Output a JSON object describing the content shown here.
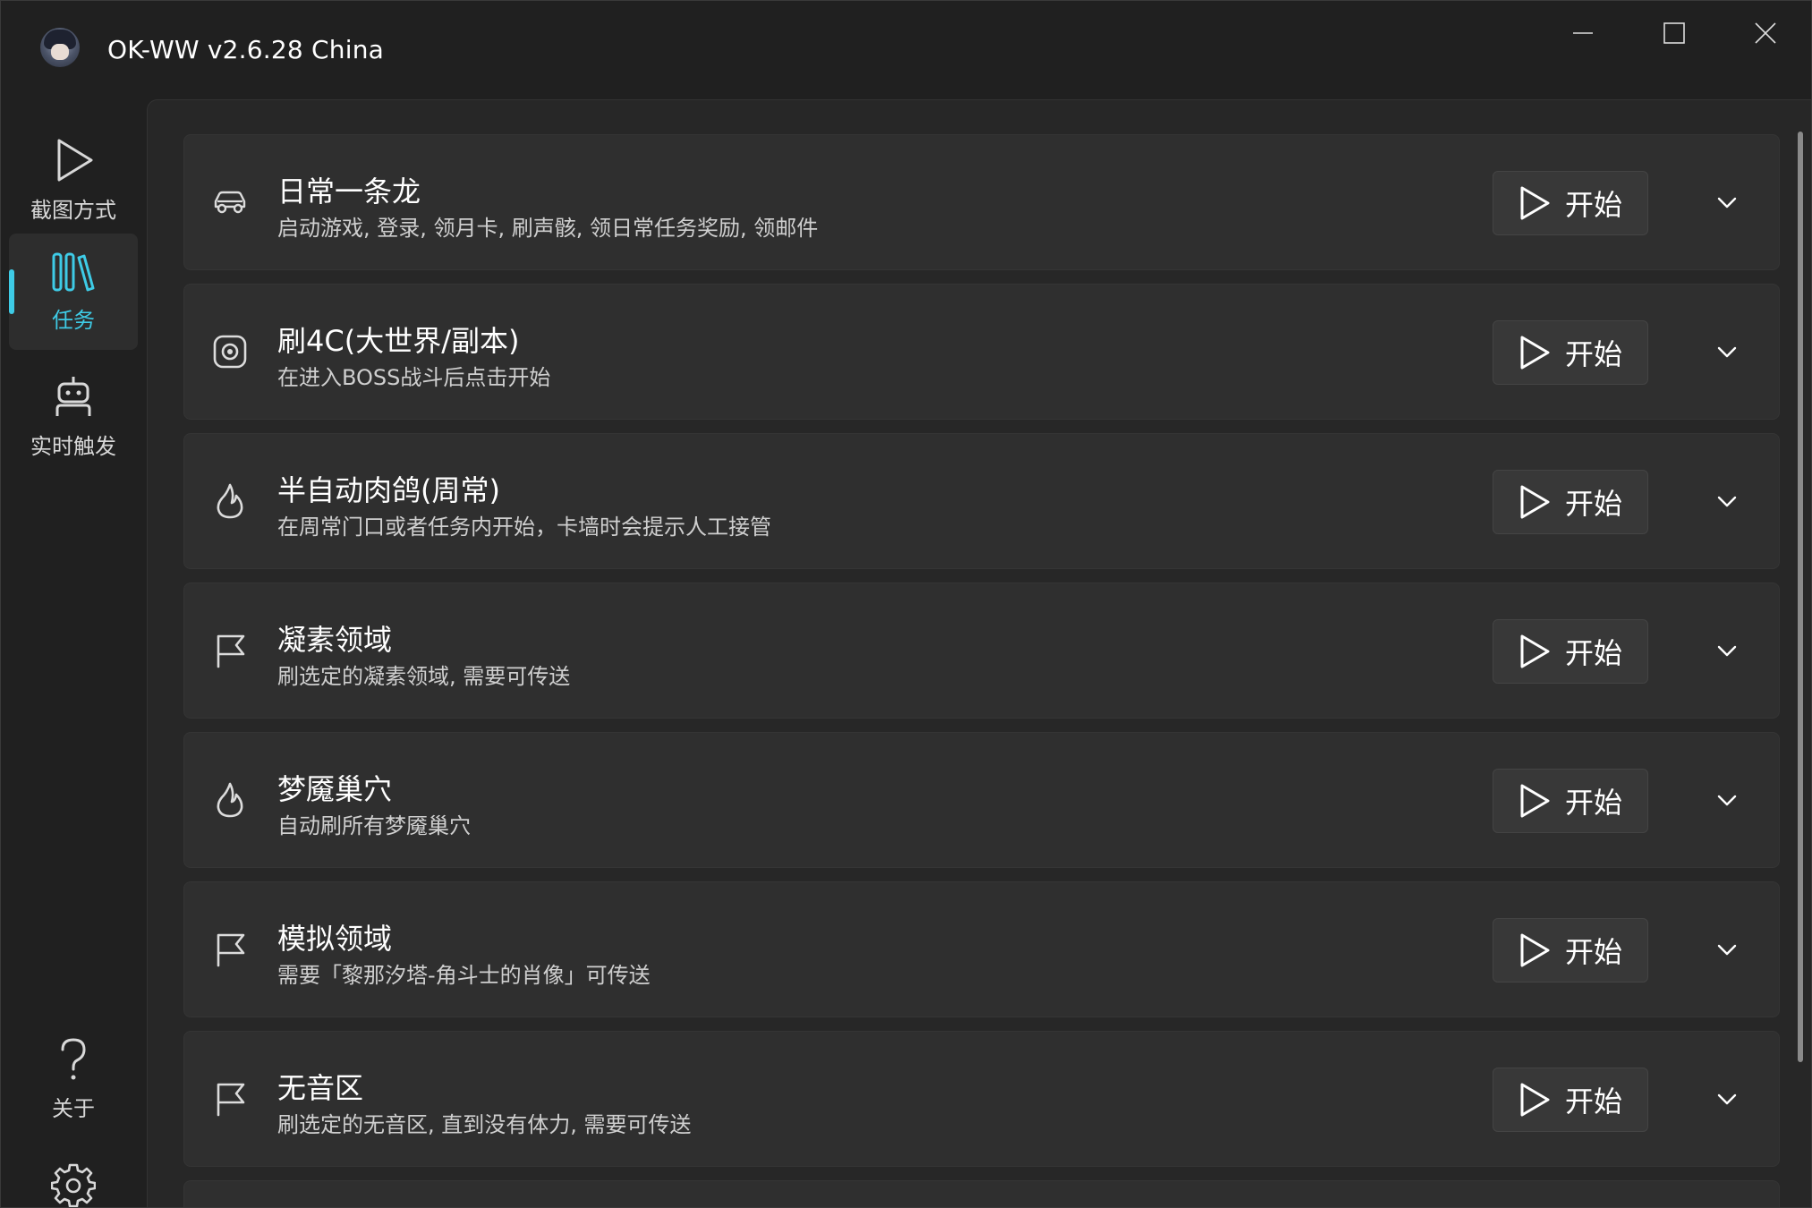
{
  "window": {
    "title": "OK-WW v2.6.28 China"
  },
  "sidebar": {
    "items": [
      {
        "label": "截图方式",
        "icon": "play-icon",
        "active": false
      },
      {
        "label": "任务",
        "icon": "library-icon",
        "active": true
      },
      {
        "label": "实时触发",
        "icon": "robot-icon",
        "active": false
      }
    ],
    "bottom_items": [
      {
        "label": "关于",
        "icon": "question-icon"
      },
      {
        "label": "设置",
        "icon": "gear-icon"
      }
    ]
  },
  "tasks": [
    {
      "title": "日常一条龙",
      "desc": "启动游戏, 登录, 领月卡, 刷声骸, 领日常任务奖励, 领邮件",
      "icon": "car-icon",
      "start_label": "开始"
    },
    {
      "title": "刷4C(大世界/副本)",
      "desc": "在进入BOSS战斗后点击开始",
      "icon": "target-icon",
      "start_label": "开始"
    },
    {
      "title": "半自动肉鸽(周常)",
      "desc": "在周常门口或者任务内开始，卡墙时会提示人工接管",
      "icon": "fire-icon",
      "start_label": "开始"
    },
    {
      "title": "凝素领域",
      "desc": "刷选定的凝素领域, 需要可传送",
      "icon": "flag-icon",
      "start_label": "开始"
    },
    {
      "title": "梦魇巢穴",
      "desc": "自动刷所有梦魇巢穴",
      "icon": "fire-icon",
      "start_label": "开始"
    },
    {
      "title": "模拟领域",
      "desc": "需要「黎那汐塔-角斗士的肖像」可传送",
      "icon": "flag-icon",
      "start_label": "开始"
    },
    {
      "title": "无音区",
      "desc": "刷选定的无音区, 直到没有体力, 需要可传送",
      "icon": "flag-icon",
      "start_label": "开始"
    }
  ],
  "colors": {
    "accent": "#3ecbe6",
    "background": "#202020",
    "card": "#2f2f2f"
  }
}
